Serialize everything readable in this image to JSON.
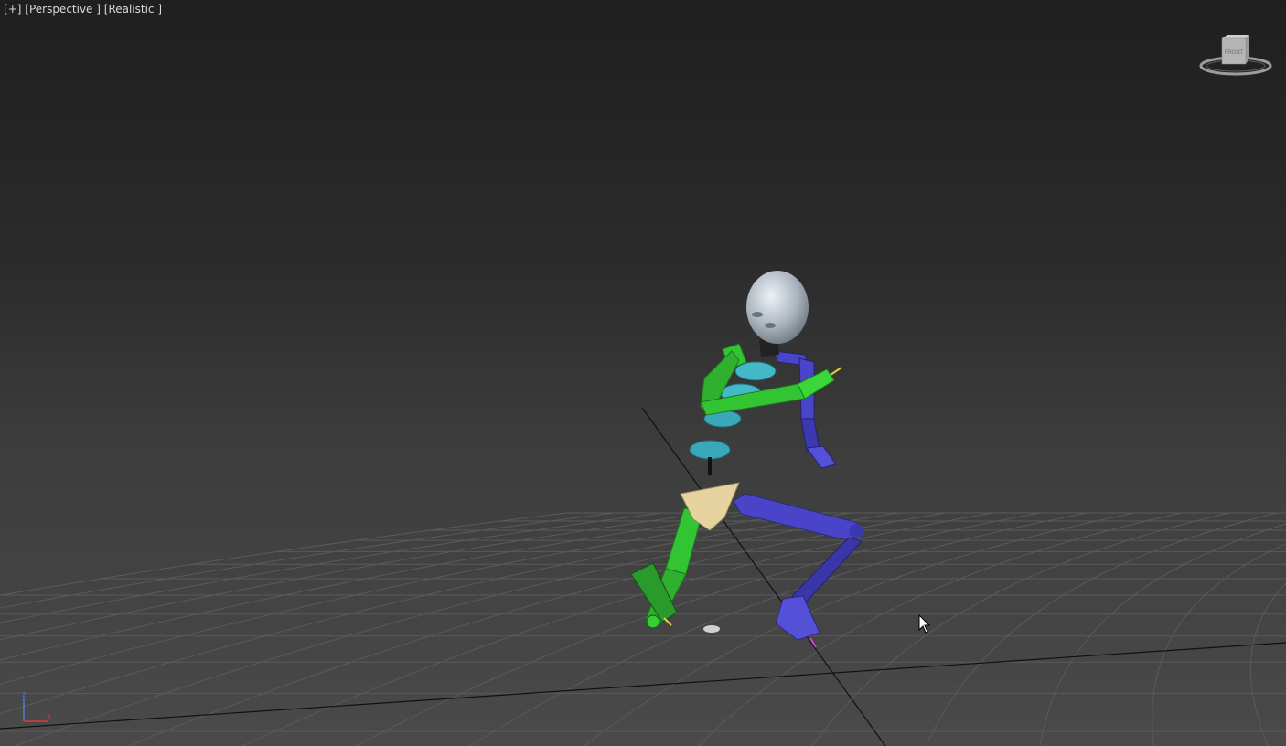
{
  "viewport": {
    "label_parts": [
      "[",
      "+",
      "] [",
      "Perspective",
      " ] [",
      "Realistic",
      " ]"
    ],
    "plus_label": "+",
    "view_label": "Perspective",
    "shading_label": "Realistic"
  },
  "viewcube": {
    "face_label": "FRONT",
    "icon": "viewcube-icon"
  },
  "axis_gizmo": {
    "z_label": "z",
    "x_label": "x",
    "z_color": "#4a7fd0",
    "x_color": "#d04040"
  },
  "scene": {
    "object_name": "biped-skeleton",
    "left_side_color": "#33c433",
    "right_side_color": "#4a45c8",
    "spine_color": "#3aa8b8",
    "pelvis_color": "#e6d3a0",
    "head_color": "#c8d0d8",
    "grid_color": "#555555",
    "axis_line_color": "#111111"
  },
  "cursor": {
    "icon": "mouse-cursor-icon"
  }
}
